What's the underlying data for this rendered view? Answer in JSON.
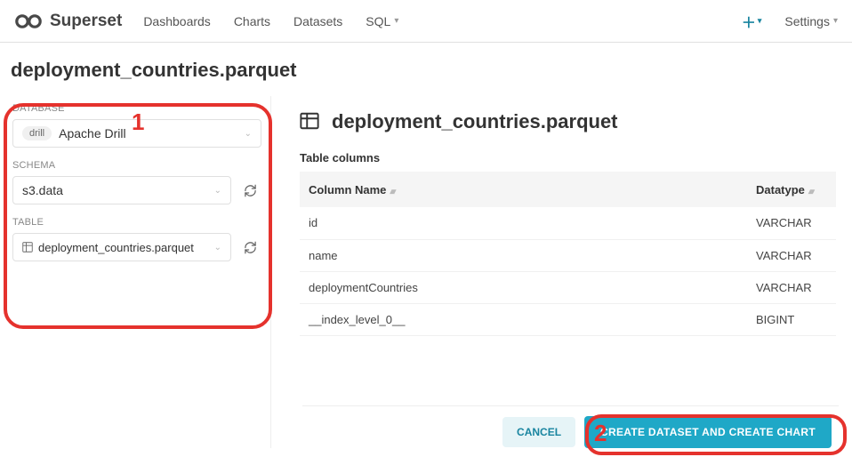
{
  "header": {
    "logo_text": "Superset",
    "nav": [
      "Dashboards",
      "Charts",
      "Datasets",
      "SQL"
    ],
    "settings_label": "Settings"
  },
  "page_title": "deployment_countries.parquet",
  "left": {
    "database_label": "DATABASE",
    "database_badge": "drill",
    "database_value": "Apache Drill",
    "schema_label": "SCHEMA",
    "schema_value": "s3.data",
    "table_label": "TABLE",
    "table_value": "deployment_countries.parquet"
  },
  "right": {
    "table_name": "deployment_countries.parquet",
    "section_label": "Table columns",
    "col_header_name": "Column Name",
    "col_header_type": "Datatype",
    "rows": [
      {
        "name": "id",
        "type": "VARCHAR"
      },
      {
        "name": "name",
        "type": "VARCHAR"
      },
      {
        "name": "deploymentCountries",
        "type": "VARCHAR"
      },
      {
        "name": "__index_level_0__",
        "type": "BIGINT"
      }
    ]
  },
  "footer": {
    "cancel": "CANCEL",
    "create": "CREATE DATASET AND CREATE CHART"
  },
  "annotations": {
    "num1": "1",
    "num2": "2"
  }
}
